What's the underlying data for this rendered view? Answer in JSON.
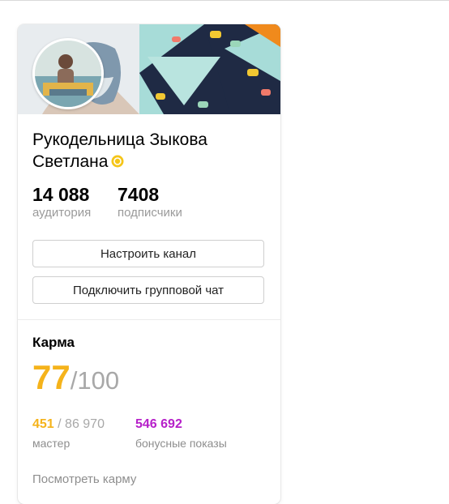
{
  "channel": {
    "name": "Рукодельница Зыкова Светлана",
    "stats": [
      {
        "value": "14 088",
        "label": "аудитория"
      },
      {
        "value": "7408",
        "label": "подписчики"
      }
    ]
  },
  "buttons": {
    "configure": "Настроить канал",
    "group_chat": "Подключить групповой чат"
  },
  "karma": {
    "title": "Карма",
    "score": "77",
    "max": "/100",
    "metrics": [
      {
        "value": "451",
        "total": " / 86 970",
        "label": "мастер"
      },
      {
        "value": "546 692",
        "label": "бонусные показы"
      }
    ],
    "view_link": "Посмотреть карму"
  },
  "colors": {
    "karma_accent": "#f5b31b",
    "bonus_accent": "#b620c9",
    "verified_badge": "#f5c518"
  }
}
